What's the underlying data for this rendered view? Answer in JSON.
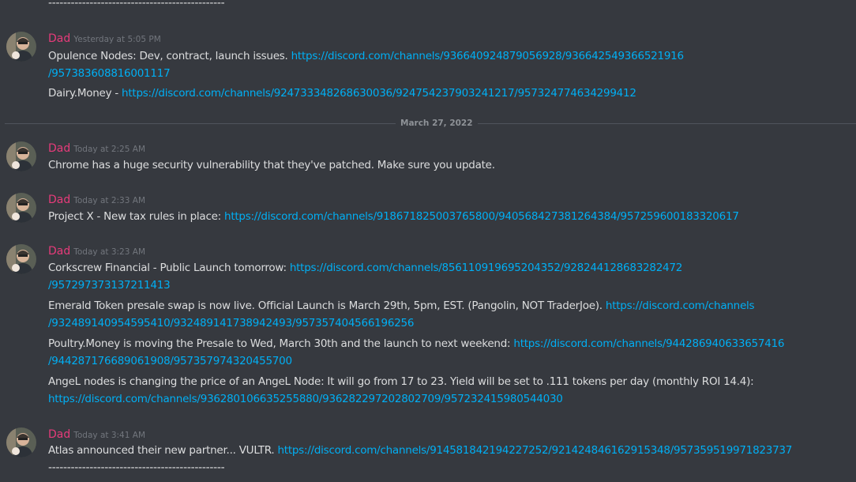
{
  "top_separator": "-----------------------------------------------",
  "bottom_separator": "-----------------------------------------------",
  "date_divider": "March 27, 2022",
  "username_color": "#e63b7a",
  "link_color": "#00aff4",
  "groups": [
    {
      "author": "Dad",
      "avatar": "dad-avatar",
      "timestamp": "Yesterday at 5:05 PM",
      "messages": [
        {
          "prefix": "Opulence Nodes: Dev, contract, launch issues. ",
          "link_line1": "https://discord.com/channels/936640924879056928/936642549366521916",
          "link_line2": "/957383608816001117"
        },
        {
          "prefix": "Dairy.Money - ",
          "link": "https://discord.com/channels/924733348268630036/924754237903241217/957324774634299412"
        }
      ]
    },
    {
      "author": "Dad",
      "avatar": "dad-avatar",
      "timestamp": "Today at 2:25 AM",
      "messages": [
        {
          "text": "Chrome has a huge security vulnerability that they've patched.  Make sure you update."
        }
      ]
    },
    {
      "author": "Dad",
      "avatar": "dad-avatar",
      "timestamp": "Today at 2:33 AM",
      "messages": [
        {
          "prefix": "Project X - New tax rules in place: ",
          "link": "https://discord.com/channels/918671825003765800/940568427381264384/957259600183320617"
        }
      ]
    },
    {
      "author": "Dad",
      "avatar": "dad-avatar",
      "timestamp": "Today at 3:23 AM",
      "messages": [
        {
          "prefix": "Corkscrew Financial - Public Launch tomorrow: ",
          "link_line1": "https://discord.com/channels/856110919695204352/928244128683282472",
          "link_line2": "/957297373137211413"
        },
        {
          "prefix": "Emerald Token presale swap is now live.  Official Launch is March 29th, 5pm, EST.  (Pangolin, NOT TraderJoe). ",
          "link_line1": "https://discord.com/channels",
          "link_line2": "/932489140954595410/932489141738942493/957357404566196256"
        },
        {
          "prefix": "Poultry.Money is moving the Presale to Wed, March 30th and the launch to next weekend: ",
          "link_line1": "https://discord.com/channels/944286940633657416",
          "link_line2": "/944287176689061908/957357974320455700"
        },
        {
          "prefix": "AngeL nodes is changing the price of an AngeL Node: It will go from 17 to 23.  Yield will be set to .111 tokens per day (monthly ROI 14.4):",
          "link_line2": "https://discord.com/channels/936280106635255880/936282297202802709/957232415980544030"
        }
      ]
    },
    {
      "author": "Dad",
      "avatar": "dad-avatar",
      "timestamp": "Today at 3:41 AM",
      "messages": [
        {
          "prefix": "Atlas announced their new partner... VULTR.  ",
          "link": "https://discord.com/channels/914581842194227252/921424846162915348/957359519971823737"
        }
      ]
    }
  ]
}
